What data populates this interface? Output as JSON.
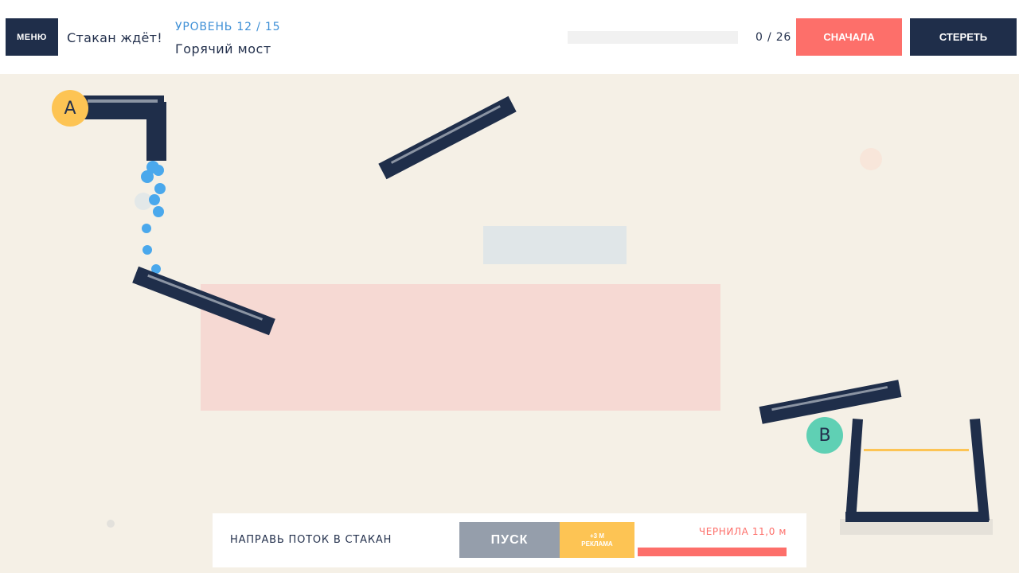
{
  "header": {
    "menu_label": "МЕНЮ",
    "status_text": "Стакан ждёт!",
    "level_label": "УРОВЕНЬ 12 / 15",
    "level_name": "Горячий мост",
    "progress_fraction": 0,
    "counter": "0 / 26",
    "restart_label": "СНАЧАЛА",
    "erase_label": "СТЕРЕТЬ"
  },
  "field": {
    "start_marker": "A",
    "goal_marker": "B"
  },
  "bottom": {
    "hint": "НАПРАВЬ ПОТОК В СТАКАН",
    "play_label": "ПУСК",
    "ad_line1": "+3 М",
    "ad_line2": "РЕКЛАМА",
    "ink_label": "ЧЕРНИЛА  11,0 м",
    "ink_fraction": 1
  },
  "colors": {
    "background": "#f5f0e6",
    "dark": "#1f2e4a",
    "accent_red": "#fd6f6a",
    "accent_yellow": "#fdc454",
    "accent_teal": "#5fd0b4",
    "water": "#4aa8ec",
    "hot_zone": "#f6d9d3"
  }
}
